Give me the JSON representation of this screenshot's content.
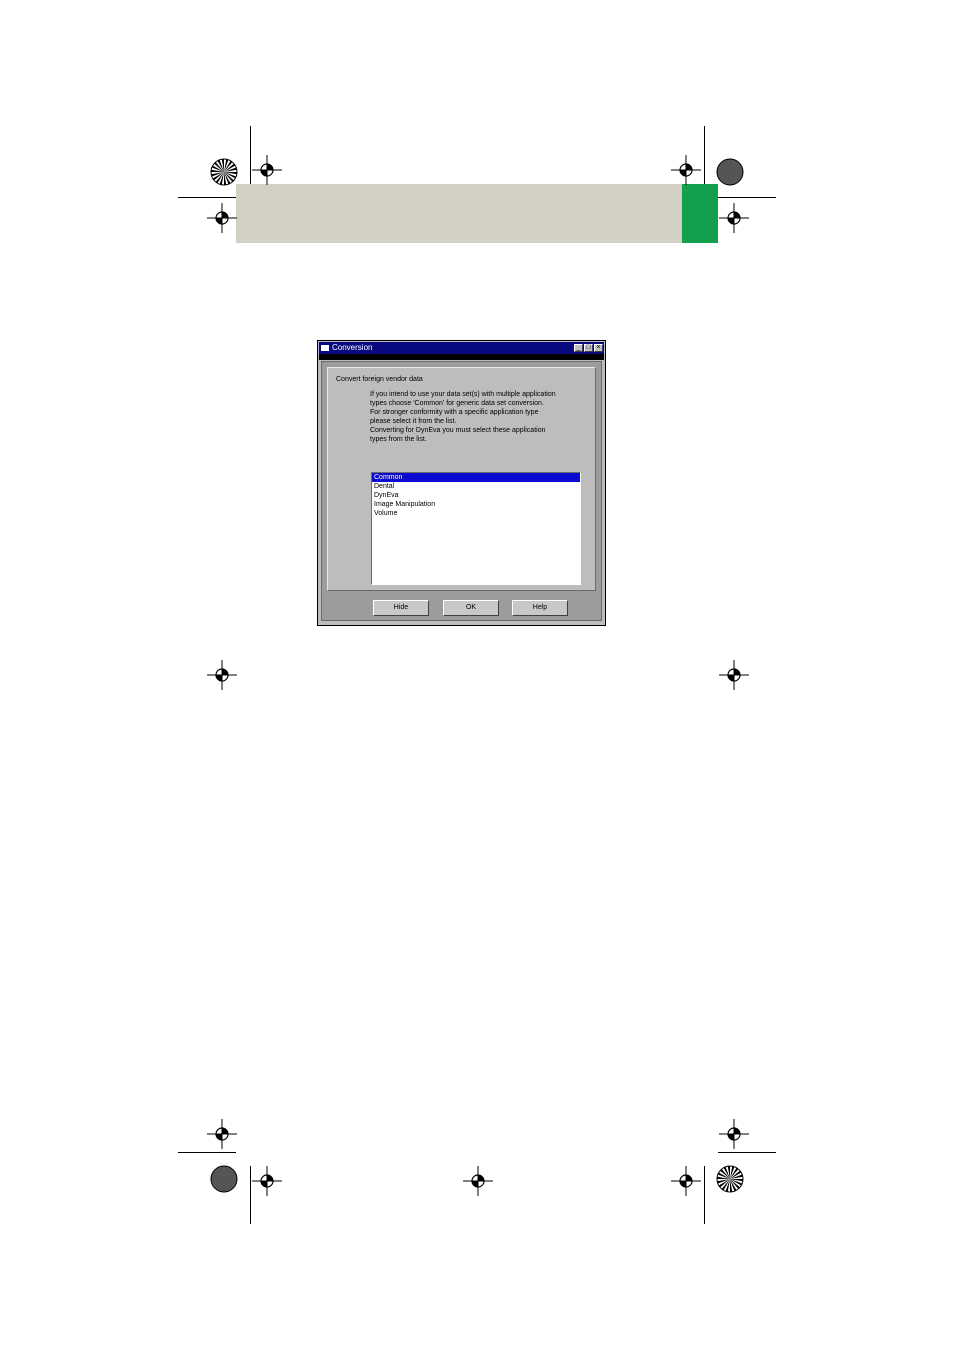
{
  "window": {
    "title": "Conversion",
    "controls": {
      "minimize": "_",
      "maximize": "□",
      "close": "×"
    }
  },
  "panel": {
    "heading": "Convert foreign vendor data",
    "description_lines": [
      "If you intend to use your data set(s) with multiple application",
      "types choose 'Common' for generic data set conversion.",
      "For stronger conformity with a specific application type",
      "please select it from the list.",
      "Converting for DynEva you must select these application",
      "types from the list."
    ]
  },
  "list": {
    "items": [
      "Common",
      "Dental",
      "DynEva",
      "Image Manipulation",
      "Volume"
    ],
    "selected": "Common"
  },
  "buttons": {
    "hide": "Hide",
    "ok": "OK",
    "help": "Help"
  },
  "colors": {
    "header_band": "#d1d0c3",
    "header_tab": "#13a04c",
    "titlebar": "#0a0a80",
    "selection": "#0a0ad0"
  }
}
